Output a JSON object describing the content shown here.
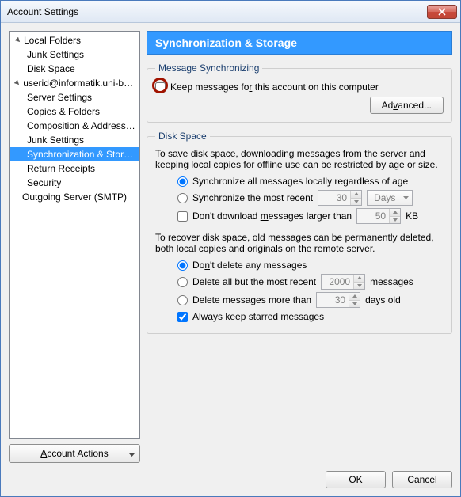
{
  "window": {
    "title": "Account Settings"
  },
  "tree": {
    "local_folders": "Local Folders",
    "local_junk": "Junk Settings",
    "local_disk": "Disk Space",
    "account": "userid@informatik.uni-bonn...",
    "server_settings": "Server Settings",
    "copies_folders": "Copies & Folders",
    "composition": "Composition & Addressing",
    "junk": "Junk Settings",
    "sync": "Synchronization & Storage",
    "return": "Return Receipts",
    "security": "Security",
    "smtp": "Outgoing Server (SMTP)"
  },
  "account_actions": "Account Actions",
  "header": "Synchronization & Storage",
  "msg_sync": {
    "legend": "Message Synchronizing",
    "keep_pre": "Keep messages fo",
    "keep_u": "r",
    "keep_post": " this account on this computer",
    "advanced_pre": "Ad",
    "advanced_u": "v",
    "advanced_post": "anced..."
  },
  "disk": {
    "legend": "Disk Space",
    "desc1": "To save disk space, downloading messages from the server and keeping local copies for offline use can be restricted by age or size.",
    "sync_all": "Synchronize all messages locally regardless of age",
    "sync_recent": "Synchronize the most recent",
    "sync_recent_val": "30",
    "days": "Days",
    "dont_dl_pre": "Don't download ",
    "dont_dl_u": "m",
    "dont_dl_post": "essages larger than",
    "dont_dl_val": "50",
    "kb": "KB",
    "desc2": "To recover disk space, old messages can be permanently deleted, both local copies and originals on the remote server.",
    "dont_delete_pre": "Do",
    "dont_delete_u": "n",
    "dont_delete_post": "'t delete any messages",
    "del_but_pre": "Delete all ",
    "del_but_u": "b",
    "del_but_post": "ut the most recent",
    "del_but_val": "2000",
    "messages": "messages",
    "del_more": "Delete messages more than",
    "del_more_val": "30",
    "days_old": "days old",
    "keep_star_pre": "Always ",
    "keep_star_u": "k",
    "keep_star_post": "eep starred messages"
  },
  "footer": {
    "ok": "OK",
    "cancel": "Cancel"
  }
}
